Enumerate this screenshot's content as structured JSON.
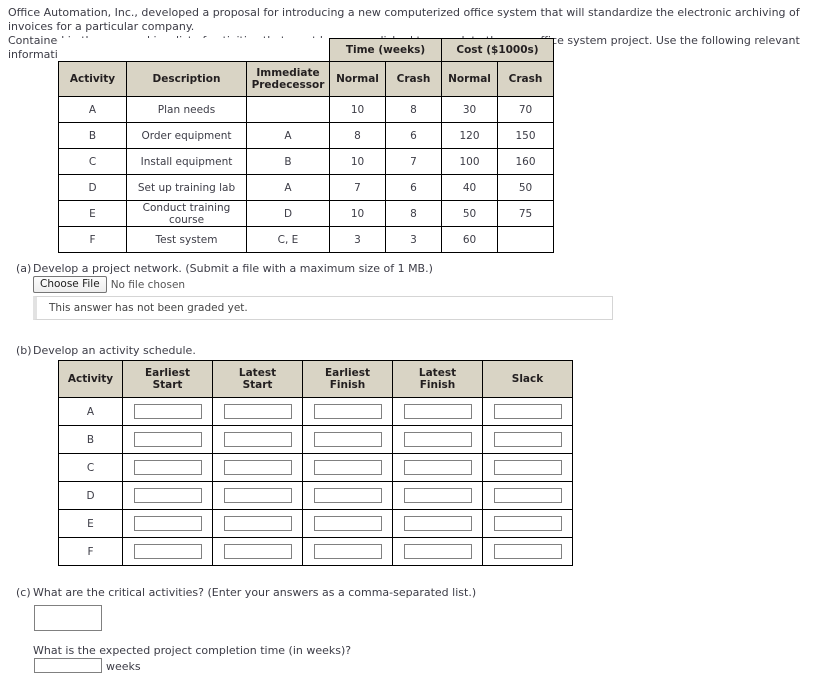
{
  "intro": {
    "line1": "Office Automation, Inc., developed a proposal for introducing a new computerized office system that will standardize the electronic archiving of invoices for a particular company.",
    "line2": "Contained in the proposal is a list of activities that must be accomplished to complete the new office system project. Use the following relevant information about the activities."
  },
  "activity_table": {
    "group_headers": {
      "time": "Time (weeks)",
      "cost": "Cost ($1000s)"
    },
    "headers": {
      "activity": "Activity",
      "description": "Description",
      "immediate_predecessor": "Immediate\nPredecessor",
      "immediate_predecessor_line1": "Immediate",
      "immediate_predecessor_line2": "Predecessor",
      "time_normal": "Normal",
      "time_crash": "Crash",
      "cost_normal": "Normal",
      "cost_crash": "Crash"
    },
    "rows": [
      {
        "activity": "A",
        "description": "Plan needs",
        "predecessor": "",
        "time_normal": "10",
        "time_crash": "8",
        "cost_normal": "30",
        "cost_crash": "70"
      },
      {
        "activity": "B",
        "description": "Order equipment",
        "predecessor": "A",
        "time_normal": "8",
        "time_crash": "6",
        "cost_normal": "120",
        "cost_crash": "150"
      },
      {
        "activity": "C",
        "description": "Install equipment",
        "predecessor": "B",
        "time_normal": "10",
        "time_crash": "7",
        "cost_normal": "100",
        "cost_crash": "160"
      },
      {
        "activity": "D",
        "description": "Set up training lab",
        "predecessor": "A",
        "time_normal": "7",
        "time_crash": "6",
        "cost_normal": "40",
        "cost_crash": "50"
      },
      {
        "activity": "E",
        "description": "Conduct training course",
        "predecessor": "D",
        "time_normal": "10",
        "time_crash": "8",
        "cost_normal": "50",
        "cost_crash": "75"
      },
      {
        "activity": "F",
        "description": "Test system",
        "predecessor": "C, E",
        "time_normal": "3",
        "time_crash": "3",
        "cost_normal": "60",
        "cost_crash": ""
      }
    ]
  },
  "part_a": {
    "marker": "(a)",
    "prompt": "Develop a project network. (Submit a file with a maximum size of 1 MB.)",
    "file_button_label": "Choose File",
    "file_status": "No file chosen",
    "file_value": "",
    "graded_notice": "This answer has not been graded yet."
  },
  "part_b": {
    "marker": "(b)",
    "prompt": "Develop an activity schedule.",
    "headers": {
      "activity": "Activity",
      "earliest_start_line1": "Earliest",
      "earliest_start_line2": "Start",
      "latest_start_line1": "Latest",
      "latest_start_line2": "Start",
      "earliest_finish_line1": "Earliest",
      "earliest_finish_line2": "Finish",
      "latest_finish_line1": "Latest",
      "latest_finish_line2": "Finish",
      "slack": "Slack"
    },
    "rows": [
      {
        "activity": "A",
        "earliest_start": "",
        "latest_start": "",
        "earliest_finish": "",
        "latest_finish": "",
        "slack": ""
      },
      {
        "activity": "B",
        "earliest_start": "",
        "latest_start": "",
        "earliest_finish": "",
        "latest_finish": "",
        "slack": ""
      },
      {
        "activity": "C",
        "earliest_start": "",
        "latest_start": "",
        "earliest_finish": "",
        "latest_finish": "",
        "slack": ""
      },
      {
        "activity": "D",
        "earliest_start": "",
        "latest_start": "",
        "earliest_finish": "",
        "latest_finish": "",
        "slack": ""
      },
      {
        "activity": "E",
        "earliest_start": "",
        "latest_start": "",
        "earliest_finish": "",
        "latest_finish": "",
        "slack": ""
      },
      {
        "activity": "F",
        "earliest_start": "",
        "latest_start": "",
        "earliest_finish": "",
        "latest_finish": "",
        "slack": ""
      }
    ]
  },
  "part_c": {
    "marker": "(c)",
    "prompt": "What are the critical activities? (Enter your answers as a comma-separated list.)",
    "critical_activities_value": "",
    "completion_prompt": "What is the expected project completion time (in weeks)?",
    "completion_time_value": "",
    "completion_unit": "weeks"
  },
  "colors": {
    "header_background": "#d9d4c5",
    "table_border": "#000000",
    "text": "#3c3c46",
    "input_border": "#808080"
  }
}
